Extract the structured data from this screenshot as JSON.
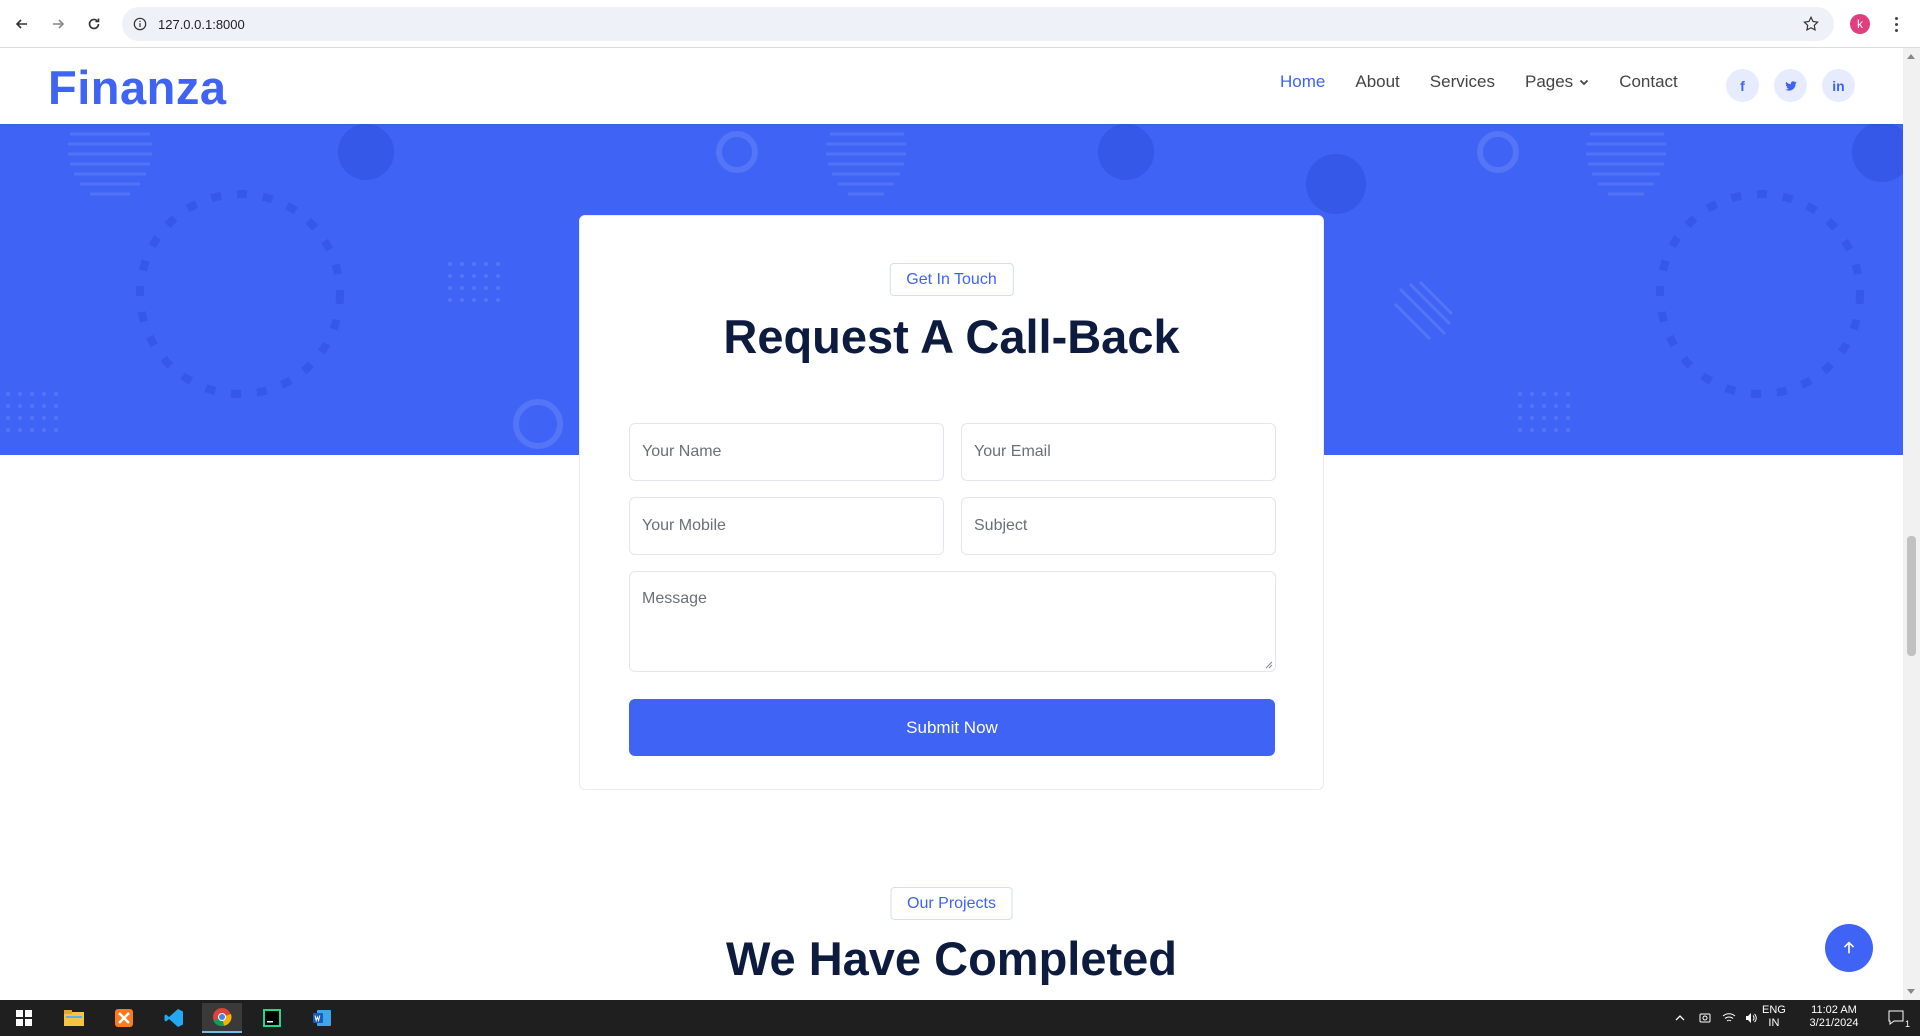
{
  "browser": {
    "url": "127.0.0.1:8000",
    "profile_initial": "k"
  },
  "site": {
    "logo": "Finanza",
    "nav": [
      {
        "label": "Home",
        "active": true
      },
      {
        "label": "About"
      },
      {
        "label": "Services"
      },
      {
        "label": "Pages"
      },
      {
        "label": "Contact"
      }
    ],
    "socials": [
      {
        "icon": "facebook-icon",
        "glyph": "f"
      },
      {
        "icon": "twitter-icon",
        "glyph": "t"
      },
      {
        "icon": "linkedin-icon",
        "glyph": "in"
      }
    ]
  },
  "callback_form": {
    "eyebrow": "Get In Touch",
    "title": "Request A Call-Back",
    "name_placeholder": "Your Name",
    "email_placeholder": "Your Email",
    "mobile_placeholder": "Your Mobile",
    "subject_placeholder": "Subject",
    "message_placeholder": "Message",
    "submit_label": "Submit Now"
  },
  "projects": {
    "eyebrow": "Our Projects",
    "title": "We Have Completed"
  },
  "taskbar": {
    "lang_top": "ENG",
    "lang_bottom": "IN",
    "time": "11:02 AM",
    "date": "3/21/2024",
    "notification_count": "1"
  },
  "colors": {
    "accent": "#3e63f5",
    "heading": "#0d1b3e"
  }
}
